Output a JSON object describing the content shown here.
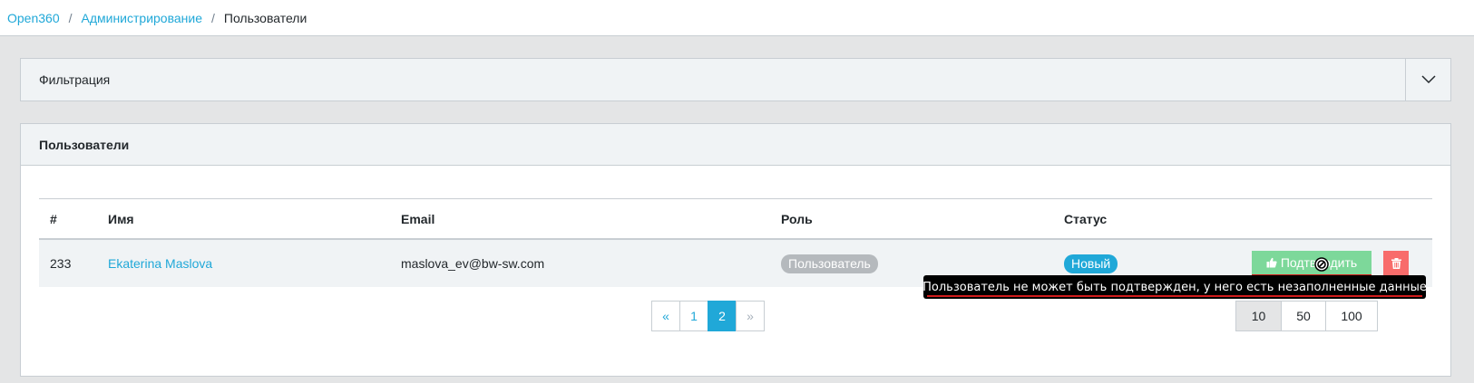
{
  "breadcrumb": {
    "items": [
      "Open360",
      "Администрирование"
    ],
    "current": "Пользователи",
    "separator": "/"
  },
  "filter": {
    "title": "Фильтрация",
    "toggle_icon": "chevron-down-icon"
  },
  "users": {
    "title": "Пользователи",
    "columns": [
      "#",
      "Имя",
      "Email",
      "Роль",
      "Статус"
    ],
    "rows": [
      {
        "id": "233",
        "name": "Ekaterina Maslova",
        "email": "maslova_ev@bw-sw.com",
        "role": "Пользователь",
        "status": "Новый",
        "approve_label": "Подтвердить",
        "approve_icon": "thumbs-up-icon",
        "delete_icon": "trash-icon"
      }
    ],
    "tooltip": "Пользователь не может быть подтвержден, у него есть незаполненные данные"
  },
  "pagination": {
    "prev": "«",
    "pages": [
      "1",
      "2"
    ],
    "active_page": "2",
    "next": "»"
  },
  "per_page": {
    "options": [
      "10",
      "50",
      "100"
    ],
    "active": "10"
  },
  "colors": {
    "accent": "#20a8d8",
    "approve": "#7dd89a",
    "delete": "#f86c6b",
    "role_badge": "#b5b9bd"
  }
}
